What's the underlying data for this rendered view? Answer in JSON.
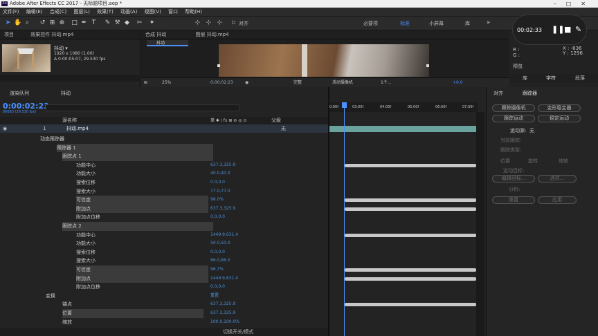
{
  "titlebar": {
    "title": "Adobe After Effects CC 2017 - 无标题项目.aep *"
  },
  "menu": [
    "文件(F)",
    "编辑(E)",
    "合成(C)",
    "图层(L)",
    "效果(T)",
    "动画(A)",
    "视图(V)",
    "窗口",
    "帮助(H)"
  ],
  "toolbar": {
    "align_label": "对齐",
    "workspaces": [
      "必要项",
      "标准",
      "小屏幕",
      "库"
    ]
  },
  "project": {
    "tab1": "项目",
    "tab2": "效果控件 抖动.mp4",
    "footage_name": "抖动 ▾",
    "footage_info1": "1920 x 1080 (1.00)",
    "footage_info2": "Δ 0:00:05:07, 29.530 fps"
  },
  "comp": {
    "tab1": "合成 抖动",
    "tab2": "图层 抖动.mp4",
    "flow_label": "抖动",
    "zoom": "25%",
    "timecode": "0:00:02:23",
    "quality": "完整",
    "camera": "活动摄像机",
    "views": "1个...",
    "exposure": "+0.0"
  },
  "recorder": {
    "time": "00:02:33"
  },
  "info": {
    "r": "R :",
    "g": "G :",
    "x": "X : -636",
    "y": "Y : 1296",
    "tabs": [
      "预览",
      "库",
      "字符",
      "段落"
    ]
  },
  "timeline": {
    "tab_render": "渲染队列",
    "tab_comp": "抖动",
    "timecode": "0:00:02:23",
    "frames": "00083 (29.530 fps)",
    "col_source": "源名称",
    "col_mode": "单 ✱ \\ fx ⊞ ⊘ ◎ ⊙",
    "col_parent": "父级",
    "layer_num": "1",
    "layer_name": "抖动.mp4",
    "parent_value": "无",
    "ruler": [
      "0:00f",
      "03:00f",
      "04:00f",
      "05:00f",
      "06:00f",
      "07:00f"
    ],
    "footer": "切换开关/模式",
    "rows": [
      {
        "name": "动态跟踪器",
        "value": ""
      },
      {
        "name": "跟踪器 1",
        "value": ""
      },
      {
        "name": "跟踪点 1",
        "value": ""
      },
      {
        "name": "功能中心",
        "value": "637.3,325.9"
      },
      {
        "name": "功能大小",
        "value": "40.0,40.0"
      },
      {
        "name": "搜索位移",
        "value": "0.0,0.0"
      },
      {
        "name": "搜索大小",
        "value": "77.0,77.0"
      },
      {
        "name": "可信度",
        "value": "98.0%"
      },
      {
        "name": "附加点",
        "value": "637.3,325.9"
      },
      {
        "name": "附加点位移",
        "value": "0.0,0.0"
      },
      {
        "name": "跟踪点 2",
        "value": ""
      },
      {
        "name": "功能中心",
        "value": "1449.9,631.4"
      },
      {
        "name": "功能大小",
        "value": "50.0,50.0"
      },
      {
        "name": "搜索位移",
        "value": "0.0,0.0"
      },
      {
        "name": "搜索大小",
        "value": "86.0,86.0"
      },
      {
        "name": "可信度",
        "value": "96.7%"
      },
      {
        "name": "附加点",
        "value": "1449.9,631.4"
      },
      {
        "name": "附加点位移",
        "value": "0.0,0.0"
      },
      {
        "name": "变换",
        "value": "重置"
      },
      {
        "name": "锚点",
        "value": "637.3,325.9"
      },
      {
        "name": "位置",
        "value": "637.3,325.9"
      },
      {
        "name": "缩放",
        "value": "100.0,100.0%"
      }
    ]
  },
  "tracker": {
    "tab_align": "对齐",
    "tab_tracker": "跟踪器",
    "btn_track_camera": "跟踪摄像机",
    "btn_warp_stabilize": "变形稳定器",
    "btn_track_motion": "跟踪运动",
    "btn_stabilize_motion": "稳定运动",
    "source_label": "运动源:",
    "source_value": "无",
    "current_track": "当前跟踪:",
    "track_type": "跟踪类型:",
    "opt_position": "位置",
    "opt_rotation": "旋转",
    "opt_scale": "缩放",
    "motion_target": "运动目标:",
    "edit_target": "编辑目标...",
    "options": "选项...",
    "analyze": "分析:",
    "reset": "重置",
    "apply": "应用"
  }
}
